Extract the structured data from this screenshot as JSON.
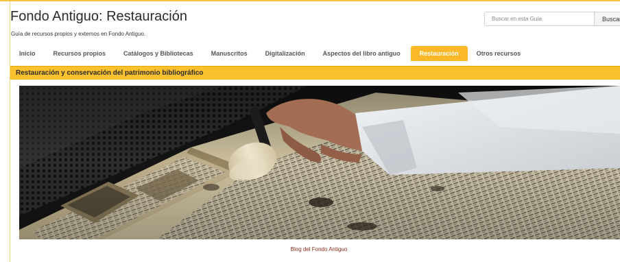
{
  "guide": {
    "title": "Fondo Antiguo: Restauración",
    "description": "Guía de recursos propios y externos en Fondo Antiguo."
  },
  "search": {
    "placeholder": "Buscar en esta Guía",
    "button_label": "Buscar"
  },
  "nav": {
    "tabs": [
      {
        "label": "Inicio",
        "active": false
      },
      {
        "label": "Recursos propios",
        "active": false
      },
      {
        "label": "Catálogos y Bibliotecas",
        "active": false
      },
      {
        "label": "Manuscritos",
        "active": false
      },
      {
        "label": "Digitalización",
        "active": false
      },
      {
        "label": "Aspectos del libro antiguo",
        "active": false
      },
      {
        "label": "Restauración",
        "active": true
      },
      {
        "label": "Otros recursos",
        "active": false
      }
    ]
  },
  "panel": {
    "title": "Restauración y conservación del patrimonio bibliográfico",
    "image_caption_link": "Blog del Fondo Antiguo"
  },
  "colors": {
    "accent": "#fbc02d",
    "active_tab": "#fcb829",
    "link": "#8a2a1c"
  },
  "icons": {
    "photo": "restoration-photo"
  }
}
